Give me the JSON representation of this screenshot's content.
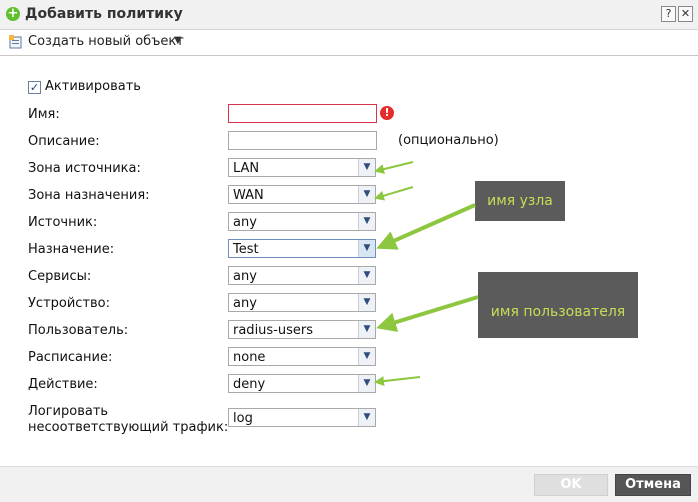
{
  "window": {
    "title": "Добавить политику",
    "help_label": "?",
    "close_label": "✕"
  },
  "toolbar": {
    "create_label": "Создать новый объект",
    "create_arrow": "▼"
  },
  "form": {
    "activate": {
      "label": "Активировать",
      "checked": true,
      "mark": "✓"
    },
    "name": {
      "label": "Имя:",
      "value": "",
      "error_mark": "!"
    },
    "description": {
      "label": "Описание:",
      "value": "",
      "hint": "(опционально)"
    },
    "source_zone": {
      "label": "Зона источника:",
      "value": "LAN"
    },
    "dest_zone": {
      "label": "Зона назначения:",
      "value": "WAN"
    },
    "source": {
      "label": "Источник:",
      "value": "any"
    },
    "destination": {
      "label": "Назначение:",
      "value": "Test"
    },
    "services": {
      "label": "Сервисы:",
      "value": "any"
    },
    "device": {
      "label": "Устройство:",
      "value": "any"
    },
    "user": {
      "label": "Пользователь:",
      "value": "radius-users"
    },
    "schedule": {
      "label": "Расписание:",
      "value": "none"
    },
    "action": {
      "label": "Действие:",
      "value": "deny"
    },
    "log": {
      "label_line1": "Логировать",
      "label_line2": "несоответствующий трафик:",
      "value": "log"
    },
    "dropdown_glyph": "▼"
  },
  "annotations": {
    "node_name": "имя узла",
    "user_name": "имя пользователя",
    "arrow_color": "#8dc63f",
    "callout_bg": "#5b5b5b",
    "callout_text_color": "#c4df56"
  },
  "footer": {
    "ok_label": "OK",
    "cancel_label": "Отмена"
  },
  "colors": {
    "error_red": "#e62b2b",
    "add_icon_green": "#5fbf2e"
  }
}
